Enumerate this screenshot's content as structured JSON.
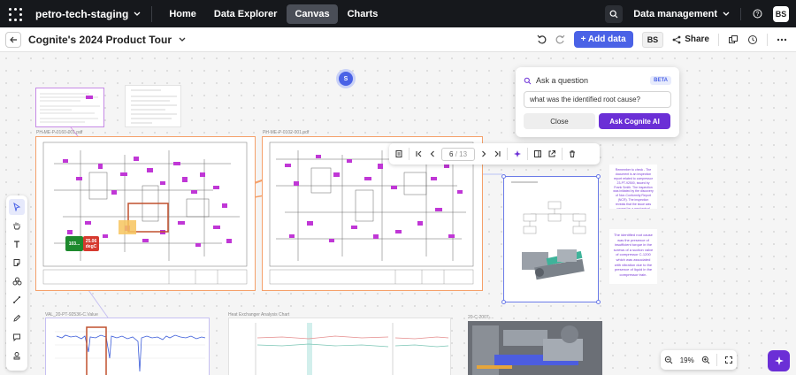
{
  "topbar": {
    "project": "petro-tech-staging",
    "tabs": [
      {
        "label": "Home",
        "active": false
      },
      {
        "label": "Data Explorer",
        "active": false
      },
      {
        "label": "Canvas",
        "active": true
      },
      {
        "label": "Charts",
        "active": false
      }
    ],
    "data_management": "Data management",
    "user_initials": "BS"
  },
  "secbar": {
    "title": "Cognite's 2024 Product Tour",
    "add_data": "+ Add data",
    "user_badge": "BS",
    "share": "Share"
  },
  "canvas": {
    "cursor_user": "S",
    "docs": {
      "pid1_label": "PH-ME-P-0160-001.pdf",
      "pid2_label": "PH-ME-P-0102-001.pdf",
      "chart1_label": "VAL_20-PT-92536-C.Value",
      "chart2_label": "Heat Exchanger Analysis Chart",
      "chart3_label": "20-C-2007-..."
    },
    "annotations": {
      "green_tag": "103...",
      "red_tag": "25.06 degC"
    },
    "notes": {
      "note1": "Remember to check - The document is an inspection report related to compressor 23-PT-92500, issued by Frank Smith. The inspection was initiated by the discovery of Non-Conformity Report (NCR). The inspection reveals that the issue was caused by a mechanical failure of the main seal of compressor 23-PT-92500...",
      "note2": "The identified root cause was the presence of insufficient torque in the screws of a suction valve of compressor C-1200 which was associated with vibration due to the presence of liquid in the compressor train."
    }
  },
  "ask": {
    "header": "Ask a question",
    "beta": "BETA",
    "question": "what was the identified root cause?",
    "close": "Close",
    "ask_button": "Ask Cognite AI"
  },
  "doc_toolbar": {
    "page": "6",
    "total": "/ 13"
  },
  "zoom": {
    "level": "19%"
  },
  "colors": {
    "accent": "#4a62e6",
    "ai_purple": "#6b2fd6",
    "pid_frame": "#f5a06a",
    "pid_magenta": "#c037d6"
  }
}
